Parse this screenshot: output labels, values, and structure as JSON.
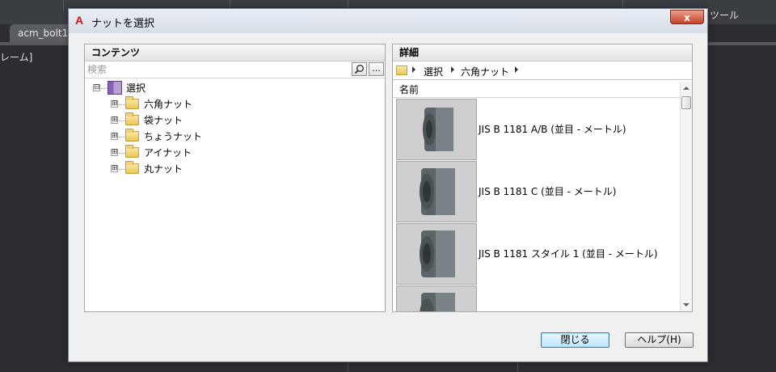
{
  "background": {
    "tab_label": "acm_bolt1",
    "left_text": "レーム]",
    "right_text": "ツール"
  },
  "dialog": {
    "title": "ナットを選択",
    "close_label": "x",
    "app_icon": "autocad-a-icon"
  },
  "contents_panel": {
    "header": "コンテンツ",
    "search_placeholder": "検索",
    "search_icon": "magnifier-icon",
    "more_label": "...",
    "tree": [
      {
        "label": "選択",
        "expander": "⊟",
        "icon": "book-icon",
        "level": 0
      },
      {
        "label": "六角ナット",
        "expander": "⊞",
        "icon": "folder-icon",
        "level": 1
      },
      {
        "label": "袋ナット",
        "expander": "⊞",
        "icon": "folder-icon",
        "level": 1
      },
      {
        "label": "ちょうナット",
        "expander": "⊞",
        "icon": "folder-icon",
        "level": 1
      },
      {
        "label": "アイナット",
        "expander": "⊞",
        "icon": "folder-icon",
        "level": 1
      },
      {
        "label": "丸ナット",
        "expander": "⊞",
        "icon": "folder-icon",
        "level": 1
      }
    ]
  },
  "details_panel": {
    "header": "詳細",
    "breadcrumb": [
      "選択",
      "六角ナット"
    ],
    "column_name": "名前",
    "items": [
      {
        "label": "JIS B 1181  A/B  (並目 - メートル)"
      },
      {
        "label": "JIS B 1181  C  (並目 - メートル)"
      },
      {
        "label": "JIS B 1181 スタイル 1  (並目 - メートル)"
      },
      {
        "label": ""
      }
    ]
  },
  "buttons": {
    "close": "閉じる",
    "help": "ヘルプ(H)"
  },
  "colors": {
    "accent": "#3c7fb1",
    "close_button": "#c7432a",
    "background": "#2b2d31"
  }
}
